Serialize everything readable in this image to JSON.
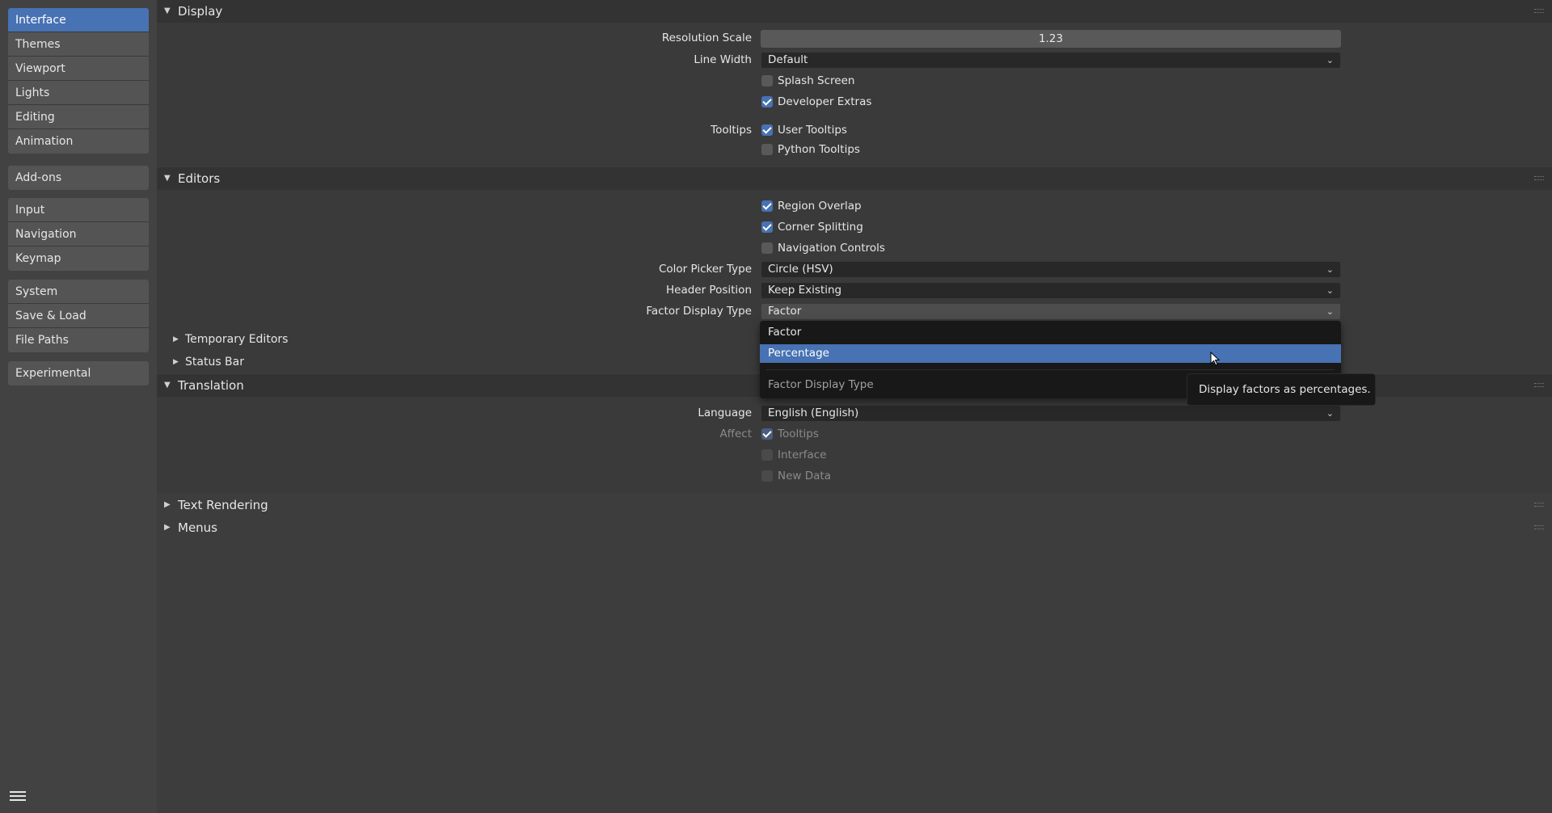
{
  "sidebar": {
    "groups": [
      {
        "items": [
          {
            "label": "Interface",
            "active": true
          },
          {
            "label": "Themes"
          },
          {
            "label": "Viewport"
          },
          {
            "label": "Lights"
          },
          {
            "label": "Editing"
          },
          {
            "label": "Animation"
          }
        ]
      },
      {
        "items": [
          {
            "label": "Add-ons"
          }
        ]
      },
      {
        "items": [
          {
            "label": "Input"
          },
          {
            "label": "Navigation"
          },
          {
            "label": "Keymap"
          }
        ]
      },
      {
        "items": [
          {
            "label": "System"
          },
          {
            "label": "Save & Load"
          },
          {
            "label": "File Paths"
          }
        ]
      },
      {
        "items": [
          {
            "label": "Experimental"
          }
        ]
      }
    ],
    "menu_icon": "hamburger-menu-icon"
  },
  "display": {
    "title": "Display",
    "resolution_scale_label": "Resolution Scale",
    "resolution_scale_value": "1.23",
    "line_width_label": "Line Width",
    "line_width_value": "Default",
    "splash_screen": {
      "label": "Splash Screen",
      "checked": false
    },
    "developer_extras": {
      "label": "Developer Extras",
      "checked": true
    },
    "tooltips_label": "Tooltips",
    "user_tooltips": {
      "label": "User Tooltips",
      "checked": true
    },
    "python_tooltips": {
      "label": "Python Tooltips",
      "checked": false
    }
  },
  "editors": {
    "title": "Editors",
    "region_overlap": {
      "label": "Region Overlap",
      "checked": true
    },
    "corner_splitting": {
      "label": "Corner Splitting",
      "checked": true
    },
    "navigation_controls": {
      "label": "Navigation Controls",
      "checked": false
    },
    "color_picker_label": "Color Picker Type",
    "color_picker_value": "Circle (HSV)",
    "header_position_label": "Header Position",
    "header_position_value": "Keep Existing",
    "factor_display_label": "Factor Display Type",
    "factor_display_value": "Factor",
    "temporary_editors": "Temporary Editors",
    "status_bar": "Status Bar"
  },
  "translation": {
    "title": "Translation",
    "language_label": "Language",
    "language_value": "English (English)",
    "affect_label": "Affect",
    "tooltips": {
      "label": "Tooltips",
      "checked": true
    },
    "interface": {
      "label": "Interface",
      "checked": false
    },
    "new_data": {
      "label": "New Data",
      "checked": false
    }
  },
  "collapsed_panels": {
    "text_rendering": "Text Rendering",
    "menus": "Menus"
  },
  "popup": {
    "options": [
      "Factor",
      "Percentage"
    ],
    "highlighted": "Percentage",
    "title": "Factor Display Type"
  },
  "tooltip": {
    "text": "Display factors as percentages."
  },
  "colors": {
    "accent": "#4772b3",
    "background": "#3d3d3d",
    "sidebar_item": "#545454"
  }
}
